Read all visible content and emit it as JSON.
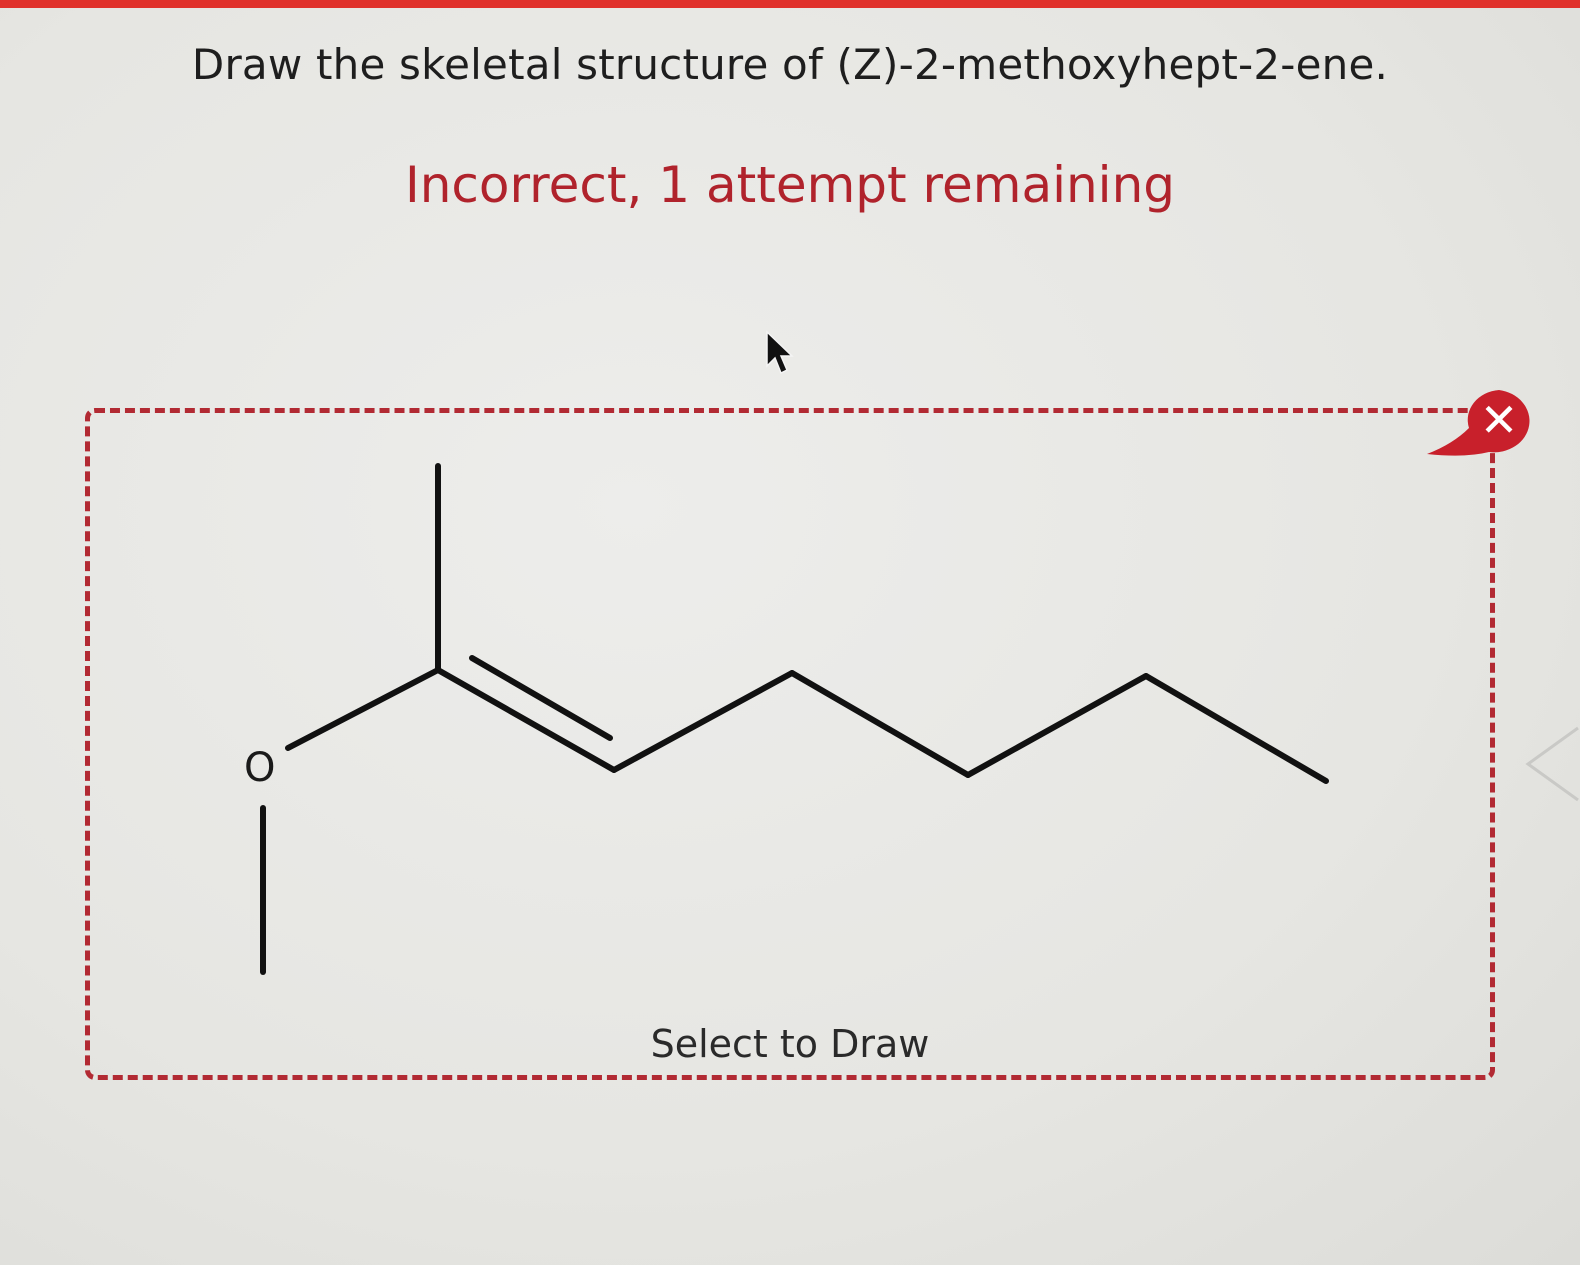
{
  "question": "Draw the skeletal structure of (Z)-2-methoxyhept-2-ene.",
  "feedback": "Incorrect, 1 attempt remaining",
  "structure": {
    "atom_label": "O"
  },
  "draw_area": {
    "prompt": "Select to Draw"
  },
  "error_badge": {
    "icon": "close-icon",
    "symbol": "✕"
  },
  "colors": {
    "accent": "#e0312b",
    "error_text": "#b0232c",
    "dashed_border": "#b22a33",
    "badge": "#c8202b"
  }
}
